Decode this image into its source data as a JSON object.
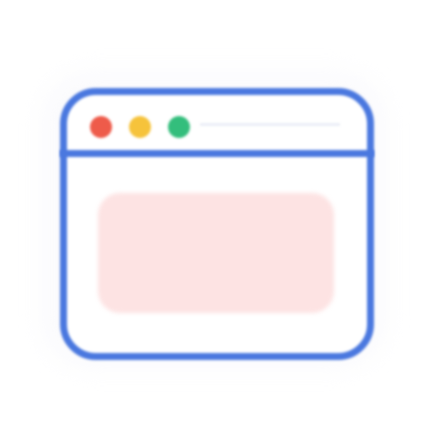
{
  "icon": {
    "name": "browser-window-icon",
    "colors": {
      "frame": "#4a78df",
      "close_dot": "#ee5b4a",
      "minimize_dot": "#f6c33b",
      "maximize_dot": "#33be7c",
      "content_panel": "#fde3e3",
      "background": "#ffffff"
    }
  }
}
